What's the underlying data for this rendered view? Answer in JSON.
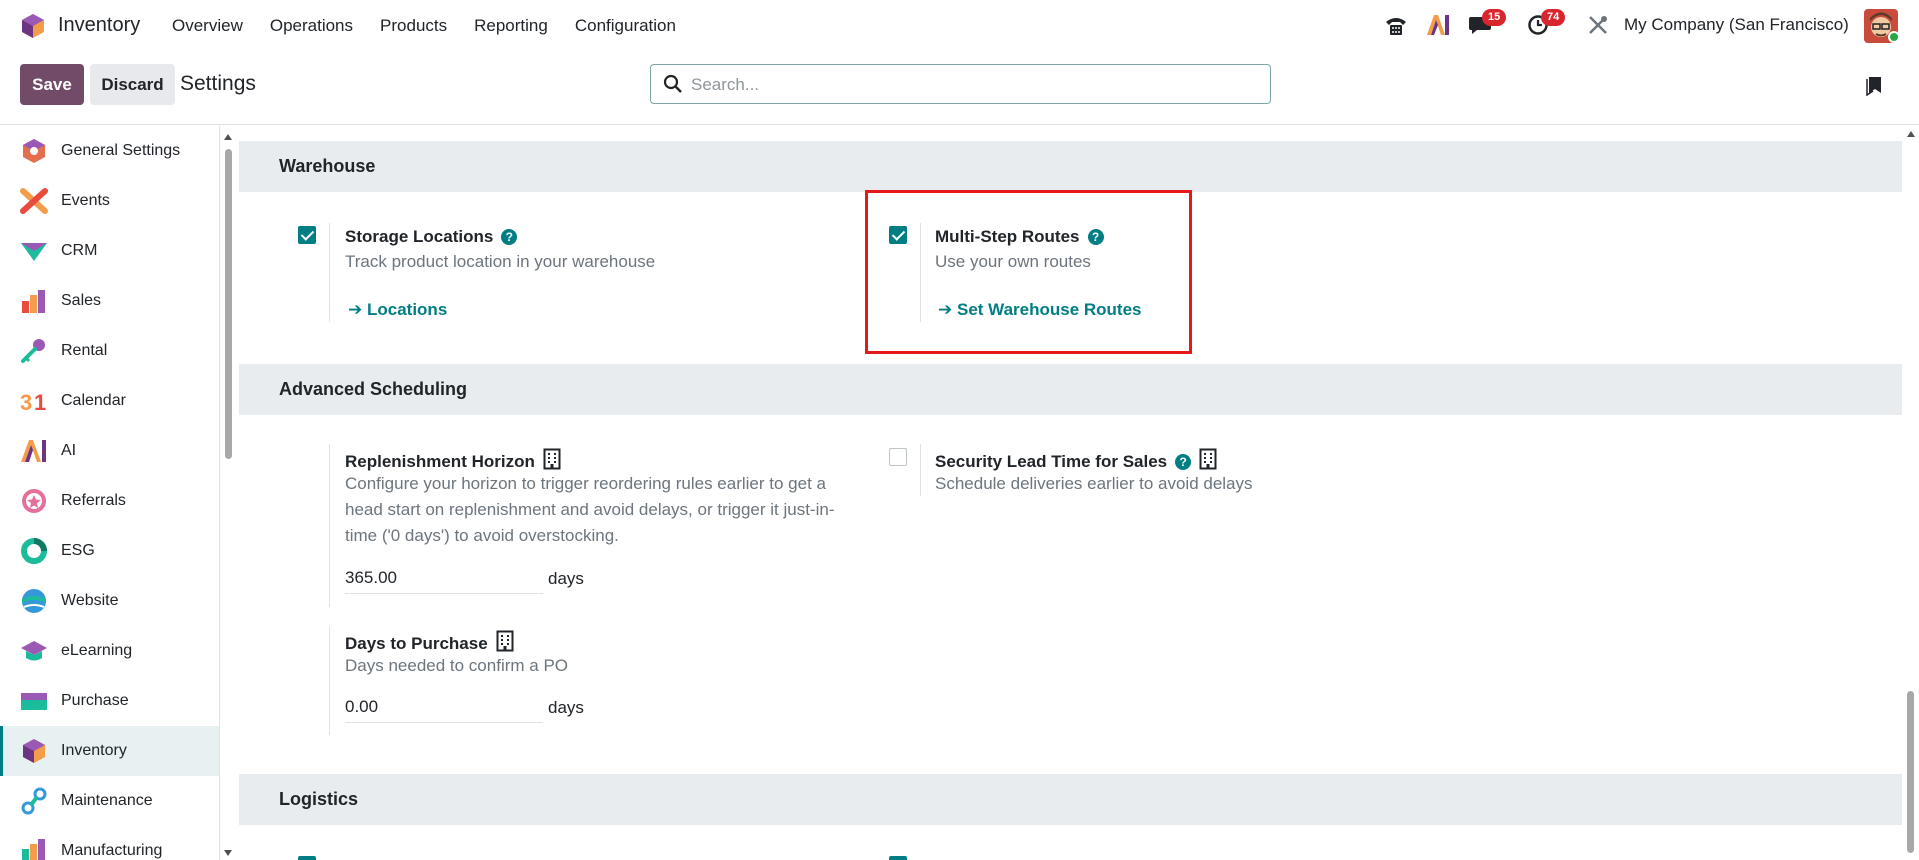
{
  "navbar": {
    "app_name": "Inventory",
    "menu": [
      "Overview",
      "Operations",
      "Products",
      "Reporting",
      "Configuration"
    ],
    "messages_badge": "15",
    "activities_badge": "74",
    "company": "My Company (San Francisco)"
  },
  "control": {
    "save_label": "Save",
    "discard_label": "Discard",
    "breadcrumb": "Settings",
    "search_placeholder": "Search..."
  },
  "sidebar": {
    "items": [
      {
        "label": "General Settings",
        "icon": "general-settings-icon"
      },
      {
        "label": "Events",
        "icon": "events-icon"
      },
      {
        "label": "CRM",
        "icon": "crm-icon"
      },
      {
        "label": "Sales",
        "icon": "sales-icon"
      },
      {
        "label": "Rental",
        "icon": "rental-icon"
      },
      {
        "label": "Calendar",
        "icon": "calendar-icon"
      },
      {
        "label": "AI",
        "icon": "ai-icon"
      },
      {
        "label": "Referrals",
        "icon": "referrals-icon"
      },
      {
        "label": "ESG",
        "icon": "esg-icon"
      },
      {
        "label": "Website",
        "icon": "website-icon"
      },
      {
        "label": "eLearning",
        "icon": "elearning-icon"
      },
      {
        "label": "Purchase",
        "icon": "purchase-icon"
      },
      {
        "label": "Inventory",
        "icon": "inventory-icon",
        "active": true
      },
      {
        "label": "Maintenance",
        "icon": "maintenance-icon"
      },
      {
        "label": "Manufacturing",
        "icon": "manufacturing-icon"
      }
    ]
  },
  "sections": {
    "warehouse": "Warehouse",
    "advanced_scheduling": "Advanced Scheduling",
    "logistics": "Logistics"
  },
  "settings": {
    "storage_locations": {
      "title": "Storage Locations",
      "desc": "Track product location in your warehouse",
      "link": "Locations",
      "checked": true
    },
    "multi_step_routes": {
      "title": "Multi-Step Routes",
      "desc": "Use your own routes",
      "link": "Set Warehouse Routes",
      "checked": true
    },
    "replenishment_horizon": {
      "title": "Replenishment Horizon",
      "desc": "Configure your horizon to trigger reordering rules earlier to get a head start on replenishment and avoid delays, or trigger it just-in-time ('0 days') to avoid overstocking.",
      "value": "365.00",
      "unit": "days"
    },
    "security_lead_time": {
      "title": "Security Lead Time for Sales",
      "desc": "Schedule deliveries earlier to avoid delays",
      "checked": false
    },
    "days_to_purchase": {
      "title": "Days to Purchase",
      "desc": "Days needed to confirm a PO",
      "value": "0.00",
      "unit": "days"
    }
  },
  "colors": {
    "primary": "#714b67",
    "accent": "#017e84",
    "highlight": "#e51919",
    "badge": "#d9262e"
  }
}
